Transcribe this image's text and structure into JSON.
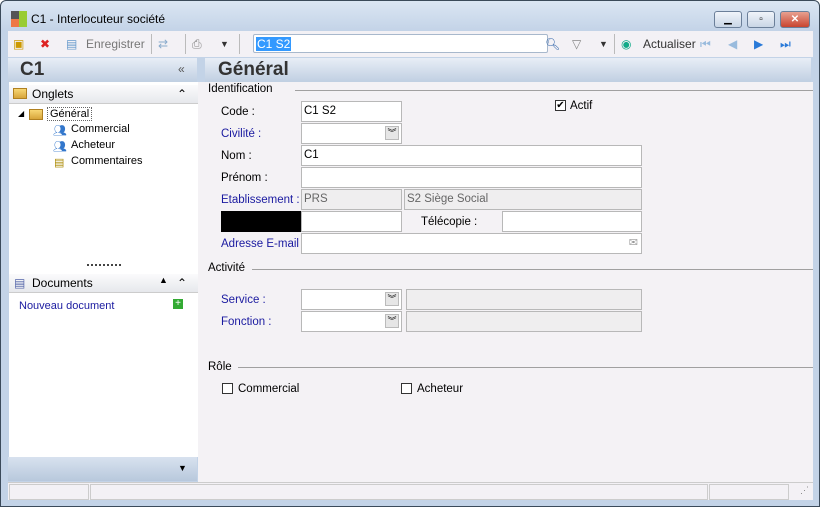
{
  "window": {
    "title": "C1 -  Interlocuteur société"
  },
  "toolbar": {
    "save_label": "Enregistrer",
    "search_value": "C1 S2",
    "refresh_label": "Actualiser"
  },
  "left": {
    "header": "C1",
    "onglets_title": "Onglets",
    "tree": [
      "Général",
      "Commercial",
      "Acheteur",
      "Commentaires"
    ],
    "documents_title": "Documents",
    "new_document": "Nouveau document"
  },
  "main": {
    "header": "Général",
    "identification": {
      "title": "Identification",
      "code_label": "Code :",
      "code_value": "C1 S2",
      "actif_label": "Actif",
      "civilite_label": "Civilité :",
      "nom_label": "Nom :",
      "nom_value": "C1",
      "prenom_label": "Prénom :",
      "etab_label": "Etablissement :",
      "etab_code": "PRS",
      "etab_name": "S2 Siège Social",
      "telecopie_label": "Télécopie :",
      "email_label": "Adresse E-mail :"
    },
    "activite": {
      "title": "Activité",
      "service_label": "Service :",
      "fonction_label": "Fonction :"
    },
    "role": {
      "title": "Rôle",
      "commercial_label": "Commercial",
      "acheteur_label": "Acheteur"
    }
  }
}
